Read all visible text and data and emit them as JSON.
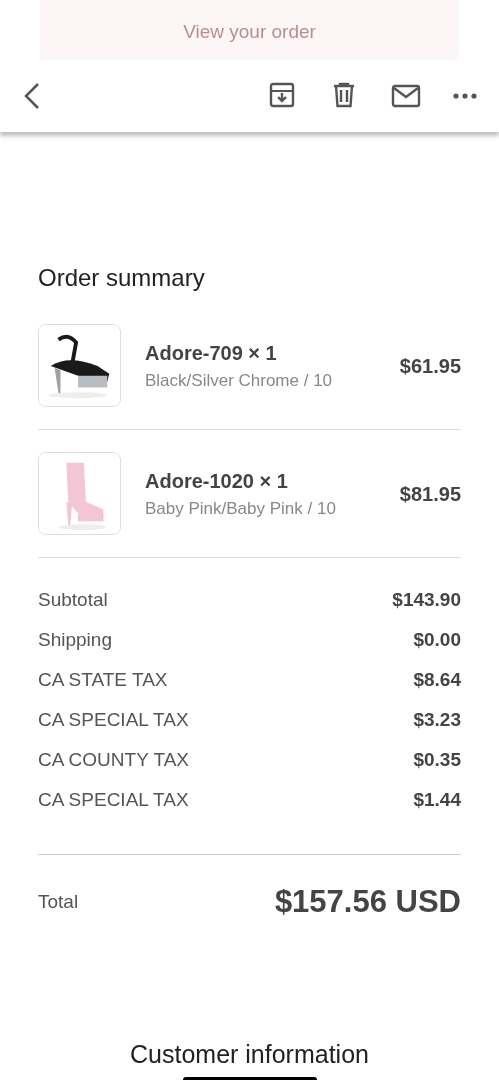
{
  "banner": {
    "text": "View your order"
  },
  "toolbar": {
    "actions": [
      {
        "kind": "archive"
      },
      {
        "kind": "delete"
      },
      {
        "kind": "mail"
      },
      {
        "kind": "more"
      }
    ]
  },
  "order_summary": {
    "title": "Order summary",
    "items": [
      {
        "name": "Adore-709 × 1",
        "variant": "Black/Silver Chrome / 10",
        "price": "$61.95"
      },
      {
        "name": "Adore-1020 × 1",
        "variant": "Baby Pink/Baby Pink / 10",
        "price": "$81.95"
      }
    ],
    "lines": [
      {
        "label": "Subtotal",
        "value": "$143.90"
      },
      {
        "label": "Shipping",
        "value": "$0.00"
      },
      {
        "label": "CA STATE TAX",
        "value": "$8.64"
      },
      {
        "label": "CA SPECIAL TAX",
        "value": "$3.23"
      },
      {
        "label": "CA COUNTY TAX",
        "value": "$0.35"
      },
      {
        "label": "CA SPECIAL TAX",
        "value": "$1.44"
      }
    ],
    "total": {
      "label": "Total",
      "value": "$157.56 USD"
    }
  },
  "next_section": {
    "title": "Customer information"
  }
}
